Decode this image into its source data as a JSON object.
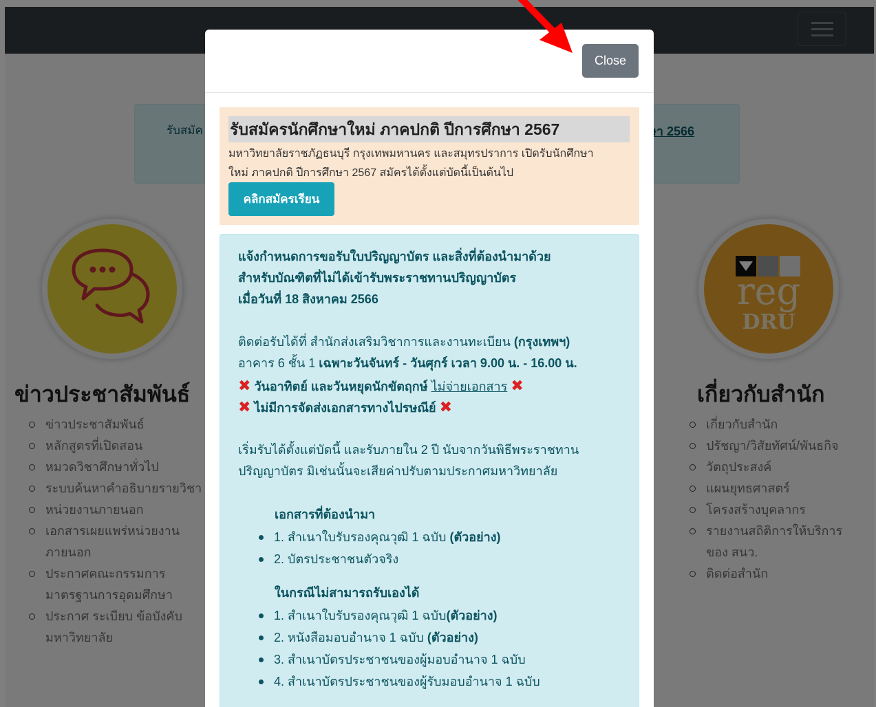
{
  "background": {
    "alert": {
      "left_text": "รับสมัค",
      "right_link": "ษา 2566"
    },
    "left_column": {
      "icon": "speech-bubbles-icon",
      "title": "ข่าวประชาสัมพันธ์",
      "links": [
        "ข่าวประชาสัมพันธ์",
        "หลักสูตรที่เปิดสอน",
        "หมวดวิชาศึกษาทั่วไป",
        "ระบบค้นหาคำอธิบายรายวิชา",
        "หน่วยงานภายนอก",
        "เอกสารเผยแพร่หน่วยงาน\nภายนอก",
        "ประกาศคณะกรรมการ\nมาตรฐานการอุดมศึกษา",
        "ประกาศ ระเบียบ ข้อบังคับ\nมหาวิทยาลัย"
      ]
    },
    "right_column": {
      "logo": {
        "word": "reg",
        "sub": "DRU"
      },
      "title": "เกี่ยวกับสำนัก",
      "links": [
        "เกี่ยวกับสำนัก",
        "ปรัชญา/วิสัยทัศน์/พันธกิจ",
        "วัตถุประสงค์",
        "แผนยุทธศาสตร์",
        "โครงสร้างบุคลากร",
        "รายงานสถิติการให้บริการ\nของ สนว.",
        "ติดต่อสำนัก"
      ]
    }
  },
  "modal": {
    "close_label": "Close",
    "admission": {
      "title": "รับสมัครนักศึกษาใหม่ ภาคปกติ ปีการศึกษา 2567",
      "desc_line1": "มหาวิทยาลัยราชภัฏธนบุรี กรุงเทพมหานคร และสมุทรปราการ เปิดรับนักศึกษา",
      "desc_line2": "ใหม่ ภาคปกติ ปีการศึกษา 2567 สมัครได้ตั้งแต่บัดนี้เป็นต้นไป",
      "button": "คลิกสมัครเรียน"
    },
    "notice": {
      "heading1": "แจ้งกำหนดการขอรับใบปริญญาบัตร และสิ่งที่ต้องนำมาด้วย",
      "heading2": "สำหรับบัณฑิตที่ไม่ได้เข้ารับพระราชทานปริญญาบัตร",
      "heading3": "เมื่อวันที่ 18 สิงหาคม 2566",
      "contact1_a": "ติดต่อรับได้ที่ สำนักส่งเสริมวิชาการและงานทะเบียน ",
      "contact1_b": "(กรุงเทพฯ)",
      "contact2_a": "อาคาร 6 ชั้น 1 ",
      "contact2_b": "เฉพาะวันจันทร์ - วันศุกร์ เวลา 9.00 น. - 16.00 น.",
      "x_mark": "✖",
      "closed_a": "วันอาทิตย์ และวันหยุดนักขัตฤกษ์ ",
      "closed_b": "ไม่จ่ายเอกสาร",
      "no_post": "ไม่มีการจัดส่งเอกสารทางไปรษณีย์",
      "period1": "เริ่มรับได้ตั้งแต่บัดนี้ และรับภายใน 2 ปี นับจากวันพิธีพระราชทาน",
      "period2": "ปริญญาบัตร มิเช่นนั้นจะเสียค่าปรับตามประกาศมหาวิทยาลัย",
      "docs_heading": "เอกสารที่ต้องนำมา",
      "docs": [
        {
          "text": "1. สำเนาใบรับรองคุณวุฒิ 1 ฉบับ ",
          "bold": "(ตัวอย่าง)"
        },
        {
          "text": "2. บัตรประชาชนตัวจริง",
          "bold": ""
        }
      ],
      "proxy_heading": "ในกรณีไม่สามารถรับเองได้",
      "proxy_docs": [
        {
          "text": "1. สำเนาใบรับรองคุณวุฒิ 1 ฉบับ",
          "bold": "(ตัวอย่าง)"
        },
        {
          "text": "2. หนังสือมอบอำนาจ 1 ฉบับ ",
          "bold": "(ตัวอย่าง)"
        },
        {
          "text": "3. สำเนาบัตรประชาชนของผู้มอบอำนาจ 1 ฉบับ",
          "bold": ""
        },
        {
          "text": "4. สำเนาบัตรประชาชนของผู้รับมอบอำนาจ 1 ฉบับ",
          "bold": ""
        }
      ]
    }
  },
  "colors": {
    "navbar": "#343a40",
    "close_button": "#6c757d",
    "apply_button": "#17a2b8",
    "notice_bg": "#d1ecf1",
    "admission_bg": "#fbe6d2",
    "annotation_arrow": "#ff0000"
  }
}
